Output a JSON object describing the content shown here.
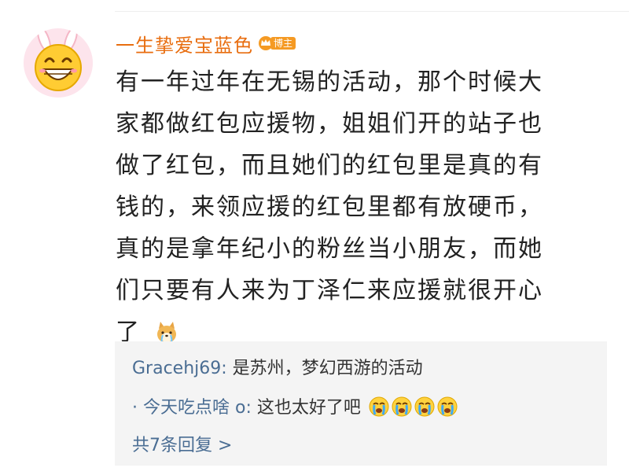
{
  "comment": {
    "username": "一生挚爱宝蓝色",
    "badge_label": "博主",
    "lines": [
      "有一年过年在无锡的活动，那个时候大",
      "家都做红包应援物，姐姐们开的站子也",
      "做了红包，而且她们的红包里是真的有",
      "钱的，来领应援的红包里都有放硬币，",
      "真的是拿年纪小的粉丝当小朋友，而她",
      "们只要有人来为丁泽仁来应援就很开心",
      "了"
    ],
    "trailing_emoji": "shiba-dog-emoji"
  },
  "replies": [
    {
      "author": "Gracehj69",
      "text": "是苏州，梦幻西游的活动",
      "emojis": []
    },
    {
      "author": "· 今天吃点啥 o",
      "text": "这也太好了吧",
      "emojis": [
        "crying-emoji",
        "crying-emoji",
        "crying-emoji",
        "crying-emoji"
      ]
    }
  ],
  "reply_separator": ": ",
  "more_replies_label": "共7条回复 >",
  "colors": {
    "username": "#e86d0f",
    "badge": "#f59a23",
    "link": "#4a6d93",
    "reply_background": "#f4f4f4"
  }
}
